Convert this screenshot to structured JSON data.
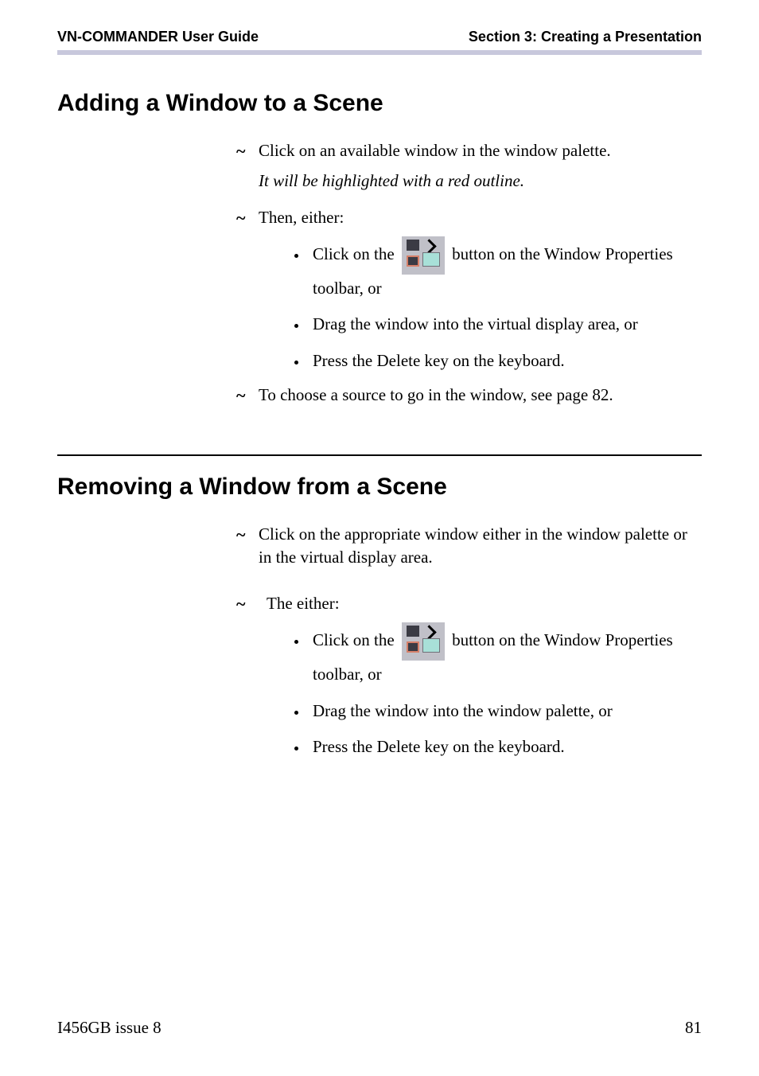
{
  "header": {
    "left": "VN-COMMANDER User Guide",
    "right": "Section 3: Creating a Presentation"
  },
  "section1": {
    "heading": "Adding a Window to a Scene",
    "step1": "Click on an available window in the window palette.",
    "step1note": "It will be highlighted with a red outline.",
    "step2": "Then, either:",
    "step2_bullets": {
      "b1_pre": "Click on the ",
      "b1_post": " button on the Window Properties toolbar, or",
      "b2": "Drag the window into the virtual display area, or",
      "b3": "Press the Delete key on the keyboard."
    },
    "step3": "To choose a source to go in the window, see page 82."
  },
  "section2": {
    "heading": "Removing a Window from a Scene",
    "step1": "Click on the appropriate window either in the window palette or in the virtual display area.",
    "step2": "The either:",
    "step2_bullets": {
      "b1_pre": "Click on the ",
      "b1_post": " button on the Window Properties toolbar, or",
      "b2": "Drag the window into the window palette, or",
      "b3": "Press the Delete key on the keyboard."
    }
  },
  "footer": {
    "left": "I456GB issue 8",
    "right": "81"
  }
}
